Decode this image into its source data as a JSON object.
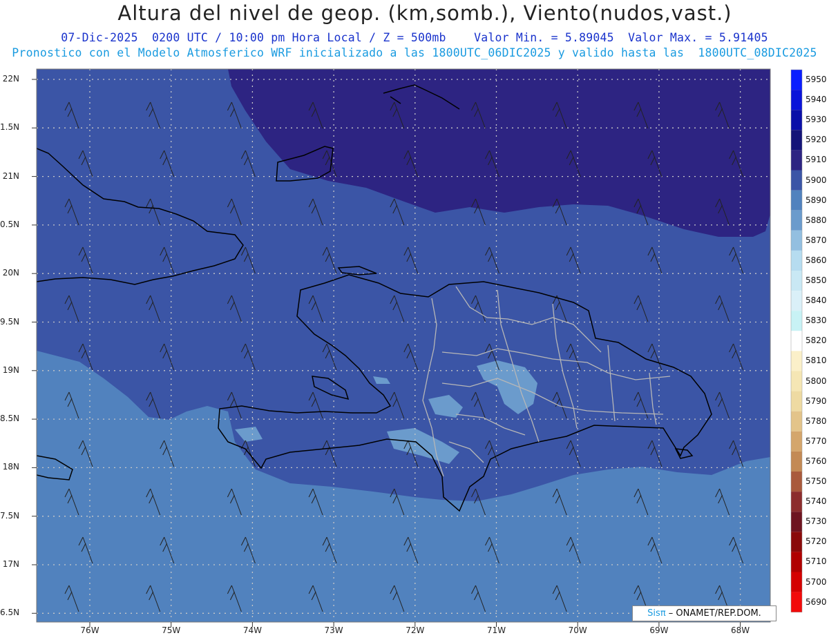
{
  "header": {
    "title": "Altura del nivel de geop. (km,somb.), Viento(nudos,vast.)",
    "line1": "07-Dic-2025  0200 UTC / 10:00 pm Hora Local / Z = 500mb    Valor Min. = 5.89045  Valor Max. = 5.91405",
    "line2": "Pronostico con el Modelo Atmosferico WRF inicializado a las 1800UTC_06DIC2025 y valido hasta las  1800UTC_08DIC2025"
  },
  "axes": {
    "lat_labels": [
      "22N",
      "1.5N",
      "21N",
      "0.5N",
      "20N",
      "9.5N",
      "19N",
      "8.5N",
      "18N",
      "7.5N",
      "17N",
      "6.5N"
    ],
    "lon_labels": [
      "76W",
      "75W",
      "74W",
      "73W",
      "72W",
      "71W",
      "70W",
      "69W",
      "68W"
    ]
  },
  "colorbar": {
    "labels": [
      "5950",
      "5940",
      "5930",
      "5920",
      "5910",
      "5900",
      "5890",
      "5880",
      "5870",
      "5860",
      "5850",
      "5840",
      "5830",
      "5820",
      "5810",
      "5800",
      "5790",
      "5780",
      "5770",
      "5760",
      "5750",
      "5740",
      "5730",
      "5720",
      "5710",
      "5700",
      "5690"
    ],
    "colors": [
      "#0a1eff",
      "#0a14d9",
      "#0a0fa8",
      "#141478",
      "#2d2482",
      "#3b55a6",
      "#5182be",
      "#6b9bcc",
      "#93bfe0",
      "#b6dcf0",
      "#c9e8f4",
      "#daf0f8",
      "#c8f2f5",
      "#ffffff",
      "#fbf0c9",
      "#f5e6b4",
      "#eedaa2",
      "#e3c48a",
      "#d4a66c",
      "#c38a55",
      "#a95a3c",
      "#8c2d2d",
      "#6e1420",
      "#8a0a0a",
      "#b00000",
      "#d40000",
      "#f20a0a"
    ]
  },
  "map": {
    "shading": {
      "far_north": "#2d2482",
      "mid": "#3b55a6",
      "south": "#5182be",
      "high": "#6b9bcc"
    }
  },
  "credit": {
    "logo": "Sis",
    "pi": "π",
    "text": "– ONAMET/REP.DOM."
  }
}
